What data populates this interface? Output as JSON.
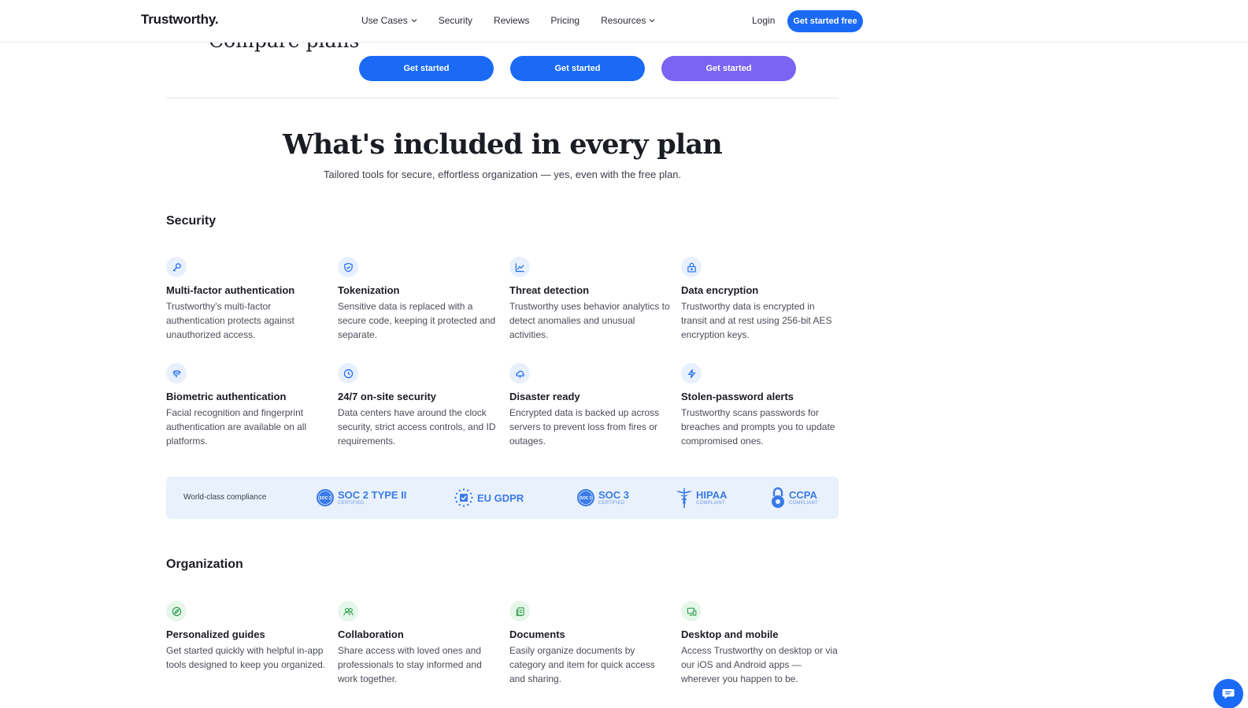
{
  "nav": {
    "logo": "Trustworthy.",
    "links": [
      {
        "label": "Use Cases",
        "dropdown": true
      },
      {
        "label": "Security",
        "dropdown": false
      },
      {
        "label": "Reviews",
        "dropdown": false
      },
      {
        "label": "Pricing",
        "dropdown": false
      },
      {
        "label": "Resources",
        "dropdown": true
      }
    ],
    "login": "Login",
    "cta": "Get started free"
  },
  "compare": {
    "title": "Compare plans",
    "buttons": [
      "Get started",
      "Get started",
      "Get started"
    ]
  },
  "hero": {
    "title": "What's included in every plan",
    "subtitle": "Tailored tools for secure, effortless organization — yes, even with the free plan."
  },
  "security": {
    "title": "Security",
    "features": [
      {
        "icon": "key-icon",
        "title": "Multi-factor authentication",
        "desc": "Trustworthy's multi-factor authentication protects against unauthorized access."
      },
      {
        "icon": "shield-check-icon",
        "title": "Tokenization",
        "desc": "Sensitive data is replaced with a secure code, keeping it protected and separate."
      },
      {
        "icon": "trend-chart-icon",
        "title": "Threat detection",
        "desc": "Trustworthy uses behavior analytics to detect anomalies and unusual activities."
      },
      {
        "icon": "lock-icon",
        "title": "Data encryption",
        "desc": "Trustworthy data is encrypted in transit and at rest using 256-bit AES encryption keys."
      },
      {
        "icon": "fingerprint-icon",
        "title": "Biometric authentication",
        "desc": "Facial recognition and fingerprint authentication are available on all platforms."
      },
      {
        "icon": "clock-icon",
        "title": "24/7 on-site security",
        "desc": "Data centers have around the clock security, strict access controls, and ID requirements."
      },
      {
        "icon": "cloud-icon",
        "title": "Disaster ready",
        "desc": "Encrypted data is backed up across servers to prevent loss from fires or outages."
      },
      {
        "icon": "lightning-icon",
        "title": "Stolen-password alerts",
        "desc": "Trustworthy scans passwords for breaches and prompts you to update compromised ones."
      }
    ]
  },
  "compliance": {
    "label": "World-class compliance",
    "badges": [
      {
        "icon": "soc2-seal-icon",
        "name": "SOC 2 TYPE II",
        "sub": "CERTIFIED",
        "seal": "SOC 2"
      },
      {
        "icon": "eu-stars-icon",
        "name": "EU GDPR",
        "sub": ""
      },
      {
        "icon": "soc3-seal-icon",
        "name": "SOC 3",
        "sub": "CERTIFIED",
        "seal": "SOC 3"
      },
      {
        "icon": "caduceus-icon",
        "name": "HIPAA",
        "sub": "COMPLIANT"
      },
      {
        "icon": "padlock-icon",
        "name": "CCPA",
        "sub": "COMPLIANT"
      }
    ]
  },
  "organization": {
    "title": "Organization",
    "features": [
      {
        "icon": "compass-icon",
        "title": "Personalized guides",
        "desc": "Get started quickly with helpful in-app tools designed to keep you organized."
      },
      {
        "icon": "people-icon",
        "title": "Collaboration",
        "desc": "Share access with loved ones and professionals to stay informed and work together."
      },
      {
        "icon": "documents-icon",
        "title": "Documents",
        "desc": "Easily organize documents by category and item for quick access and sharing."
      },
      {
        "icon": "devices-icon",
        "title": "Desktop and mobile",
        "desc": "Access Trustworthy on desktop or via our iOS and Android apps — wherever you happen to be."
      }
    ]
  },
  "colors": {
    "accent": "#1a6af5",
    "purple": "#7b63f3",
    "green": "#2e9e4b",
    "compliance_bg": "#e9f1fc"
  }
}
